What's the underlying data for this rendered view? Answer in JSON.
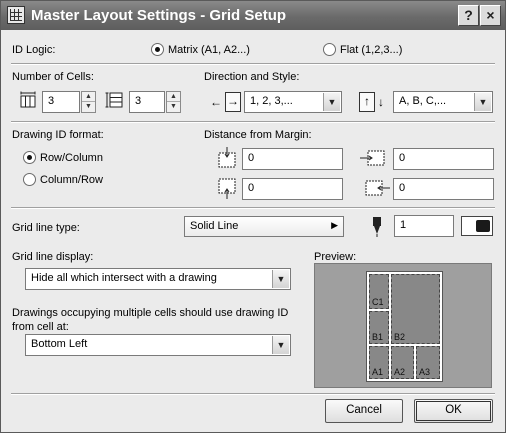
{
  "window": {
    "title": "Master Layout Settings - Grid Setup",
    "help_label": "?",
    "close_label": "×"
  },
  "id_logic": {
    "label": "ID Logic:",
    "options": [
      {
        "label": "Matrix (A1, A2...)",
        "selected": true
      },
      {
        "label": "Flat (1,2,3...)",
        "selected": false
      }
    ]
  },
  "cells": {
    "label": "Number of Cells:",
    "columns": "3",
    "rows": "3"
  },
  "direction": {
    "label": "Direction and Style:",
    "number_style": "1, 2, 3,...",
    "letter_style": "A, B, C,..."
  },
  "id_format": {
    "label": "Drawing ID format:",
    "options": [
      {
        "label": "Row/Column",
        "selected": true
      },
      {
        "label": "Column/Row",
        "selected": false
      }
    ]
  },
  "margin": {
    "label": "Distance from Margin:",
    "top": "0",
    "bottom": "0",
    "left": "0",
    "right": "0"
  },
  "grid_line": {
    "type_label": "Grid line type:",
    "type_value": "Solid Line",
    "pen": "1"
  },
  "grid_display": {
    "label": "Grid line display:",
    "value": "Hide all which intersect with a drawing"
  },
  "multi_cell": {
    "label": "Drawings occupying multiple cells should use drawing ID from cell at:",
    "value": "Bottom Left"
  },
  "preview": {
    "label": "Preview:",
    "cells": [
      "C1",
      "B2",
      "B1",
      "A1",
      "A2",
      "A3"
    ]
  },
  "buttons": {
    "cancel": "Cancel",
    "ok": "OK"
  }
}
